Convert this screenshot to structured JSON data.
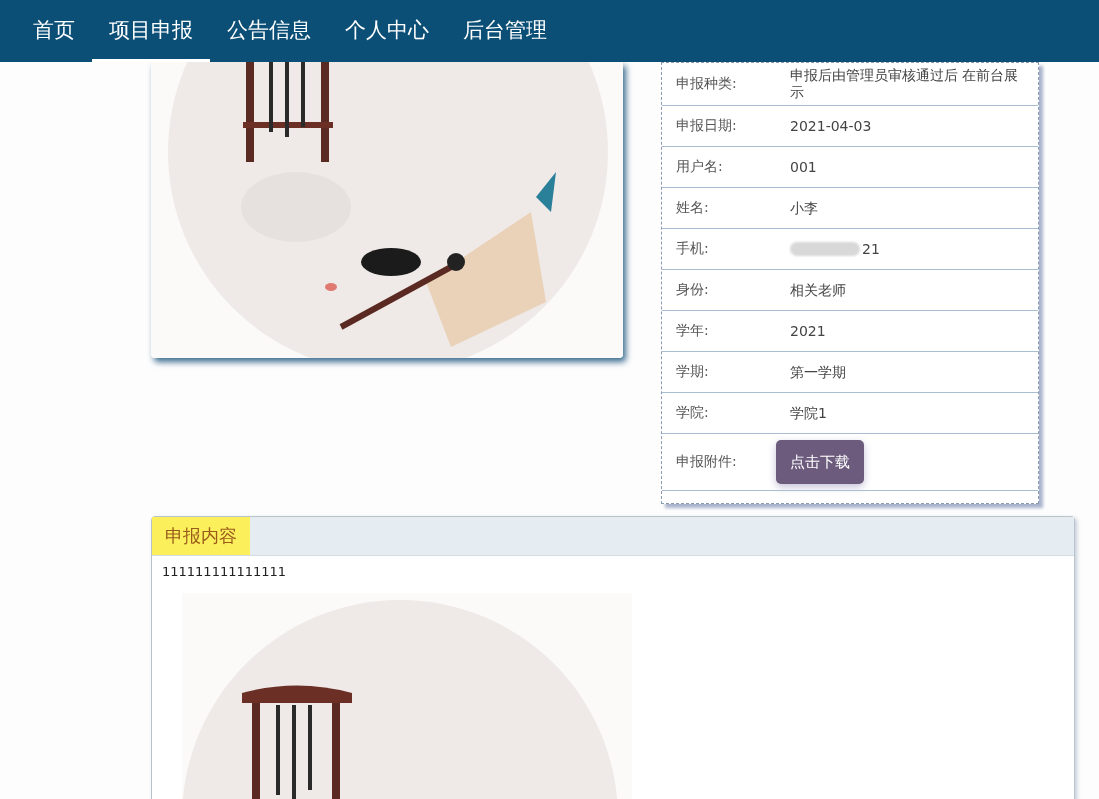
{
  "nav": [
    {
      "label": "首页",
      "selected": false
    },
    {
      "label": "项目申报",
      "selected": true
    },
    {
      "label": "公告信息",
      "selected": false
    },
    {
      "label": "个人中心",
      "selected": false
    },
    {
      "label": "后台管理",
      "selected": false
    }
  ],
  "details": [
    {
      "label": "申报种类:",
      "value": "申报后由管理员审核通过后 在前台展示",
      "kind": "text"
    },
    {
      "label": "申报日期:",
      "value": "2021-04-03",
      "kind": "text"
    },
    {
      "label": "用户名:",
      "value": "001",
      "kind": "text"
    },
    {
      "label": "姓名:",
      "value": "小李",
      "kind": "text"
    },
    {
      "label": "手机:",
      "value": "21",
      "kind": "blurred"
    },
    {
      "label": "身份:",
      "value": "相关老师",
      "kind": "text"
    },
    {
      "label": "学年:",
      "value": "2021",
      "kind": "text"
    },
    {
      "label": "学期:",
      "value": "第一学期",
      "kind": "text"
    },
    {
      "label": "学院:",
      "value": "学院1",
      "kind": "text"
    },
    {
      "label": "申报附件:",
      "value": "点击下载",
      "kind": "button"
    }
  ],
  "content_panel": {
    "tab": "申报内容",
    "text": "111111111111111"
  }
}
